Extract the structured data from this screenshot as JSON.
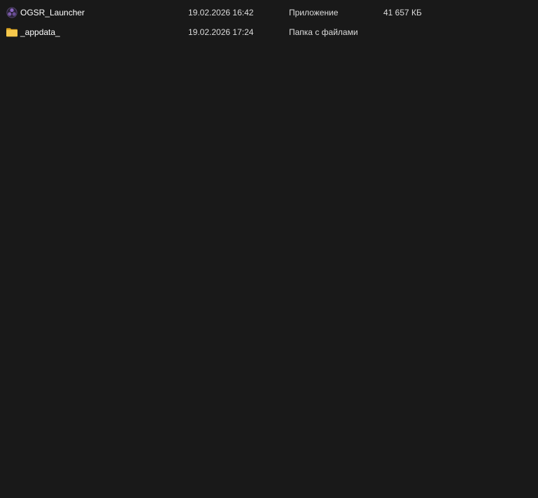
{
  "files": [
    {
      "name": "OGSR_Launcher",
      "modified": "19.02.2026 16:42",
      "type": "Приложение",
      "size": "41 657 КБ",
      "icon": "app-launcher-icon"
    },
    {
      "name": "_appdata_",
      "modified": "19.02.2026 17:24",
      "type": "Папка с файлами",
      "size": "",
      "icon": "folder-icon"
    }
  ],
  "colors": {
    "background": "#191919",
    "text": "#ffffff",
    "folder": "#f2c14e",
    "app_icon": "#7a5aa8"
  }
}
